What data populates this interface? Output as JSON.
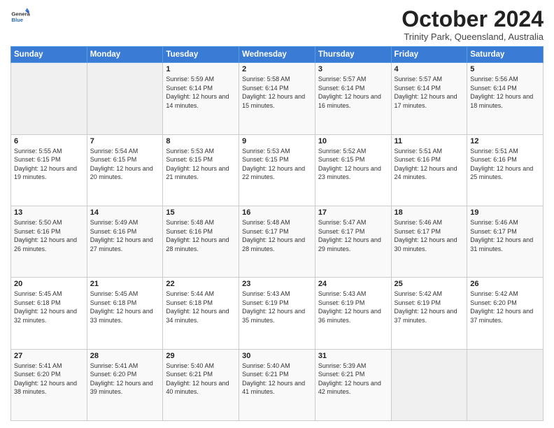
{
  "logo": {
    "general": "General",
    "blue": "Blue"
  },
  "header": {
    "month": "October 2024",
    "location": "Trinity Park, Queensland, Australia"
  },
  "days_of_week": [
    "Sunday",
    "Monday",
    "Tuesday",
    "Wednesday",
    "Thursday",
    "Friday",
    "Saturday"
  ],
  "weeks": [
    [
      null,
      null,
      {
        "day": 1,
        "sunrise": "5:59 AM",
        "sunset": "6:14 PM",
        "daylight": "12 hours and 14 minutes."
      },
      {
        "day": 2,
        "sunrise": "5:58 AM",
        "sunset": "6:14 PM",
        "daylight": "12 hours and 15 minutes."
      },
      {
        "day": 3,
        "sunrise": "5:57 AM",
        "sunset": "6:14 PM",
        "daylight": "12 hours and 16 minutes."
      },
      {
        "day": 4,
        "sunrise": "5:57 AM",
        "sunset": "6:14 PM",
        "daylight": "12 hours and 17 minutes."
      },
      {
        "day": 5,
        "sunrise": "5:56 AM",
        "sunset": "6:14 PM",
        "daylight": "12 hours and 18 minutes."
      }
    ],
    [
      {
        "day": 6,
        "sunrise": "5:55 AM",
        "sunset": "6:15 PM",
        "daylight": "12 hours and 19 minutes."
      },
      {
        "day": 7,
        "sunrise": "5:54 AM",
        "sunset": "6:15 PM",
        "daylight": "12 hours and 20 minutes."
      },
      {
        "day": 8,
        "sunrise": "5:53 AM",
        "sunset": "6:15 PM",
        "daylight": "12 hours and 21 minutes."
      },
      {
        "day": 9,
        "sunrise": "5:53 AM",
        "sunset": "6:15 PM",
        "daylight": "12 hours and 22 minutes."
      },
      {
        "day": 10,
        "sunrise": "5:52 AM",
        "sunset": "6:15 PM",
        "daylight": "12 hours and 23 minutes."
      },
      {
        "day": 11,
        "sunrise": "5:51 AM",
        "sunset": "6:16 PM",
        "daylight": "12 hours and 24 minutes."
      },
      {
        "day": 12,
        "sunrise": "5:51 AM",
        "sunset": "6:16 PM",
        "daylight": "12 hours and 25 minutes."
      }
    ],
    [
      {
        "day": 13,
        "sunrise": "5:50 AM",
        "sunset": "6:16 PM",
        "daylight": "12 hours and 26 minutes."
      },
      {
        "day": 14,
        "sunrise": "5:49 AM",
        "sunset": "6:16 PM",
        "daylight": "12 hours and 27 minutes."
      },
      {
        "day": 15,
        "sunrise": "5:48 AM",
        "sunset": "6:16 PM",
        "daylight": "12 hours and 28 minutes."
      },
      {
        "day": 16,
        "sunrise": "5:48 AM",
        "sunset": "6:17 PM",
        "daylight": "12 hours and 28 minutes."
      },
      {
        "day": 17,
        "sunrise": "5:47 AM",
        "sunset": "6:17 PM",
        "daylight": "12 hours and 29 minutes."
      },
      {
        "day": 18,
        "sunrise": "5:46 AM",
        "sunset": "6:17 PM",
        "daylight": "12 hours and 30 minutes."
      },
      {
        "day": 19,
        "sunrise": "5:46 AM",
        "sunset": "6:17 PM",
        "daylight": "12 hours and 31 minutes."
      }
    ],
    [
      {
        "day": 20,
        "sunrise": "5:45 AM",
        "sunset": "6:18 PM",
        "daylight": "12 hours and 32 minutes."
      },
      {
        "day": 21,
        "sunrise": "5:45 AM",
        "sunset": "6:18 PM",
        "daylight": "12 hours and 33 minutes."
      },
      {
        "day": 22,
        "sunrise": "5:44 AM",
        "sunset": "6:18 PM",
        "daylight": "12 hours and 34 minutes."
      },
      {
        "day": 23,
        "sunrise": "5:43 AM",
        "sunset": "6:19 PM",
        "daylight": "12 hours and 35 minutes."
      },
      {
        "day": 24,
        "sunrise": "5:43 AM",
        "sunset": "6:19 PM",
        "daylight": "12 hours and 36 minutes."
      },
      {
        "day": 25,
        "sunrise": "5:42 AM",
        "sunset": "6:19 PM",
        "daylight": "12 hours and 37 minutes."
      },
      {
        "day": 26,
        "sunrise": "5:42 AM",
        "sunset": "6:20 PM",
        "daylight": "12 hours and 37 minutes."
      }
    ],
    [
      {
        "day": 27,
        "sunrise": "5:41 AM",
        "sunset": "6:20 PM",
        "daylight": "12 hours and 38 minutes."
      },
      {
        "day": 28,
        "sunrise": "5:41 AM",
        "sunset": "6:20 PM",
        "daylight": "12 hours and 39 minutes."
      },
      {
        "day": 29,
        "sunrise": "5:40 AM",
        "sunset": "6:21 PM",
        "daylight": "12 hours and 40 minutes."
      },
      {
        "day": 30,
        "sunrise": "5:40 AM",
        "sunset": "6:21 PM",
        "daylight": "12 hours and 41 minutes."
      },
      {
        "day": 31,
        "sunrise": "5:39 AM",
        "sunset": "6:21 PM",
        "daylight": "12 hours and 42 minutes."
      },
      null,
      null
    ]
  ]
}
